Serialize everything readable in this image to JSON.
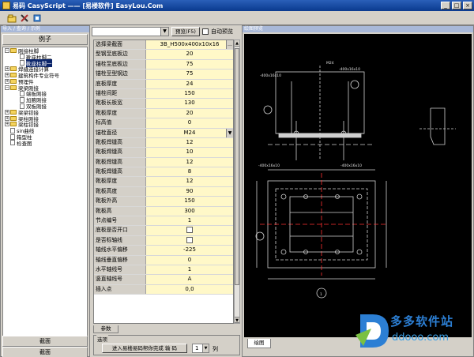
{
  "window": {
    "title": "易码 CasyScript —— [易楼软件] EasyLou.Com"
  },
  "toolbar": {
    "icons": [
      "open-icon",
      "tools-icon",
      "build-icon"
    ]
  },
  "left_panel": {
    "caption": "导入 / 查询 / 示例",
    "tab_label": "例子",
    "tree": [
      {
        "label": "刚接柱脚",
        "level": 0,
        "expanded": true,
        "type": "folder"
      },
      {
        "label": "靴座柱脚二",
        "level": 1,
        "type": "doc"
      },
      {
        "label": "靴座柱脚一",
        "level": 1,
        "type": "doc",
        "selected": true
      },
      {
        "label": "焊缝连接计算",
        "level": 0,
        "expanded": false,
        "type": "folder"
      },
      {
        "label": "建筑构件专业符号",
        "level": 0,
        "expanded": false,
        "type": "folder"
      },
      {
        "label": "预埋件",
        "level": 0,
        "expanded": false,
        "type": "folder"
      },
      {
        "label": "梁梁刚接",
        "level": 0,
        "expanded": true,
        "type": "folder"
      },
      {
        "label": "端板刚接",
        "level": 1,
        "type": "doc"
      },
      {
        "label": "加腋刚接",
        "level": 1,
        "type": "doc"
      },
      {
        "label": "双板刚接",
        "level": 1,
        "type": "doc"
      },
      {
        "label": "梁梁铰接",
        "level": 0,
        "expanded": false,
        "type": "folder"
      },
      {
        "label": "梁柱刚接",
        "level": 0,
        "expanded": false,
        "type": "folder"
      },
      {
        "label": "梁柱铰接",
        "level": 0,
        "expanded": false,
        "type": "folder"
      },
      {
        "label": "sin曲线",
        "level": 0,
        "type": "doc"
      },
      {
        "label": "箱型柱",
        "level": 0,
        "type": "doc"
      },
      {
        "label": "检查图",
        "level": 0,
        "type": "doc"
      }
    ],
    "bottom_buttons": [
      "截面",
      "截面"
    ]
  },
  "middle_panel": {
    "combo_value": "",
    "preview_button": "预览(F5)",
    "auto_preview_label": "自动预览",
    "params": [
      {
        "label": "选择梁截面",
        "value": "3B_H500x400x10x16",
        "kind": "combo"
      },
      {
        "label": "型钢至底板边",
        "value": "20"
      },
      {
        "label": "锚栓至底板边",
        "value": "75"
      },
      {
        "label": "锚栓至型钢边",
        "value": "75"
      },
      {
        "label": "底板厚度",
        "value": "24"
      },
      {
        "label": "锚栓间距",
        "value": "150"
      },
      {
        "label": "靴板长板宽",
        "value": "130"
      },
      {
        "label": "靴板厚度",
        "value": "20"
      },
      {
        "label": "标高值",
        "value": "0"
      },
      {
        "label": "锚栓直径",
        "value": "M24",
        "kind": "dropdown"
      },
      {
        "label": "靴板焊缝高",
        "value": "12"
      },
      {
        "label": "靴板焊缝高",
        "value": "10"
      },
      {
        "label": "靴板焊缝高",
        "value": "12"
      },
      {
        "label": "靴板焊缝高",
        "value": "8"
      },
      {
        "label": "靴板厚度",
        "value": "12"
      },
      {
        "label": "靴板高度",
        "value": "90"
      },
      {
        "label": "靴板外高",
        "value": "150"
      },
      {
        "label": "靴板高",
        "value": "300"
      },
      {
        "label": "节点编号",
        "value": "1"
      },
      {
        "label": "底板是否开口",
        "value": "",
        "kind": "checkbox"
      },
      {
        "label": "是否标轴线",
        "value": "",
        "kind": "checkbox"
      },
      {
        "label": "轴线水平偏移",
        "value": "-225"
      },
      {
        "label": "轴线垂直偏移",
        "value": "0"
      },
      {
        "label": "水平轴线号",
        "value": "1"
      },
      {
        "label": "竖直轴线号",
        "value": "A"
      },
      {
        "label": "插入点",
        "value": "0,0"
      }
    ],
    "param_tab": "参数",
    "group_title": "选项",
    "ok_button": "进入易楼易码帮你完成  输  码",
    "column_count": "1",
    "column_label": "列"
  },
  "right_panel": {
    "caption": "绘图预览",
    "tab_label": "绘图"
  },
  "watermark": {
    "text": "多多软件站",
    "url": "ddooo.com"
  }
}
